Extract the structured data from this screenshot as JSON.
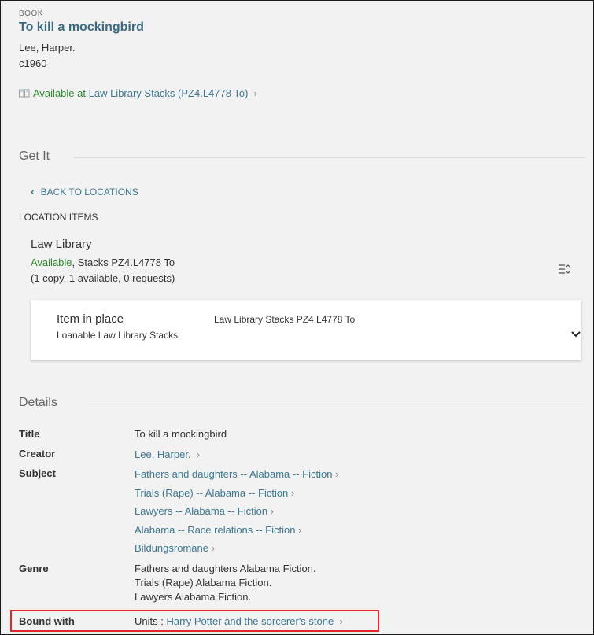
{
  "record": {
    "type": "BOOK",
    "title": "To kill a mockingbird",
    "author": "Lee, Harper.",
    "date": "c1960",
    "availability_status": "Available at",
    "availability_location": "Law Library  Stacks (PZ4.L4778 To)"
  },
  "get_it": {
    "section_title": "Get It",
    "back_label": "BACK TO LOCATIONS",
    "location_items_label": "LOCATION ITEMS",
    "location": {
      "name": "Law Library",
      "status": "Available",
      "call_detail": ", Stacks PZ4.L4778 To",
      "counts": "(1 copy, 1 available, 0 requests)"
    },
    "item": {
      "status": "Item in place",
      "policy": "Loanable Law Library Stacks",
      "location": "Law Library Stacks PZ4.L4778 To"
    }
  },
  "details": {
    "section_title": "Details",
    "title_label": "Title",
    "title_value": "To kill a mockingbird",
    "creator_label": "Creator",
    "creator_value": "Lee, Harper.",
    "subject_label": "Subject",
    "subjects": [
      "Fathers and daughters -- Alabama -- Fiction",
      "Trials (Rape) -- Alabama -- Fiction",
      "Lawyers -- Alabama -- Fiction",
      "Alabama -- Race relations -- Fiction",
      "Bildungsromane"
    ],
    "genre_label": "Genre",
    "genres": [
      "Fathers and daughters Alabama Fiction.",
      "Trials (Rape) Alabama Fiction.",
      "Lawyers Alabama Fiction."
    ],
    "bound_with_label": "Bound with",
    "bound_with_prefix": "Units :",
    "bound_with_value": "Harry Potter and the sorcerer's stone"
  },
  "icons": {
    "book": "book-icon",
    "chevron_right": "chevron-right-icon",
    "chevron_left": "chevron-left-icon",
    "chevron_down": "chevron-down-icon",
    "sort": "sort-icon"
  },
  "colors": {
    "link": "#3e7891",
    "title": "#3b6b80",
    "available": "#2f8a2f",
    "highlight_border": "#e0262d"
  }
}
